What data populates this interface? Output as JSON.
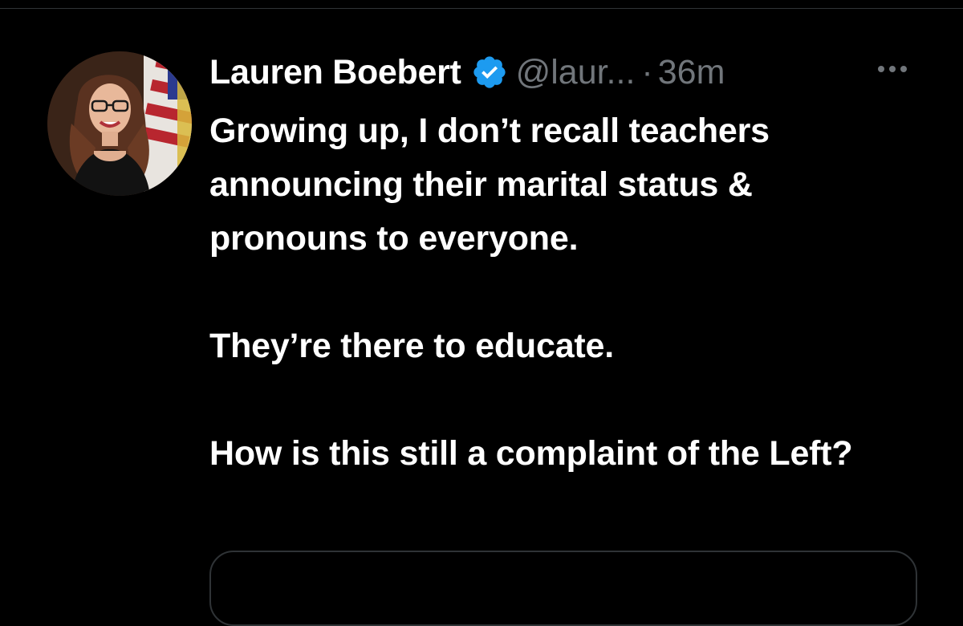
{
  "tweet": {
    "display_name": "Lauren Boebert",
    "verified": true,
    "handle": "@laur...",
    "separator": "·",
    "time": "36m",
    "more_icon": "more-horizontal-icon",
    "avatar_icon": "profile-photo",
    "paragraphs": [
      "Growing up, I don’t recall teachers announcing their marital status & pronouns to everyone.",
      "They’re there to educate.",
      "How is this still a complaint of the Left?"
    ]
  },
  "colors": {
    "background": "#000000",
    "text_primary": "#ffffff",
    "text_secondary": "#71767b",
    "verified_blue": "#1d9bf0",
    "divider": "#2f3336"
  }
}
